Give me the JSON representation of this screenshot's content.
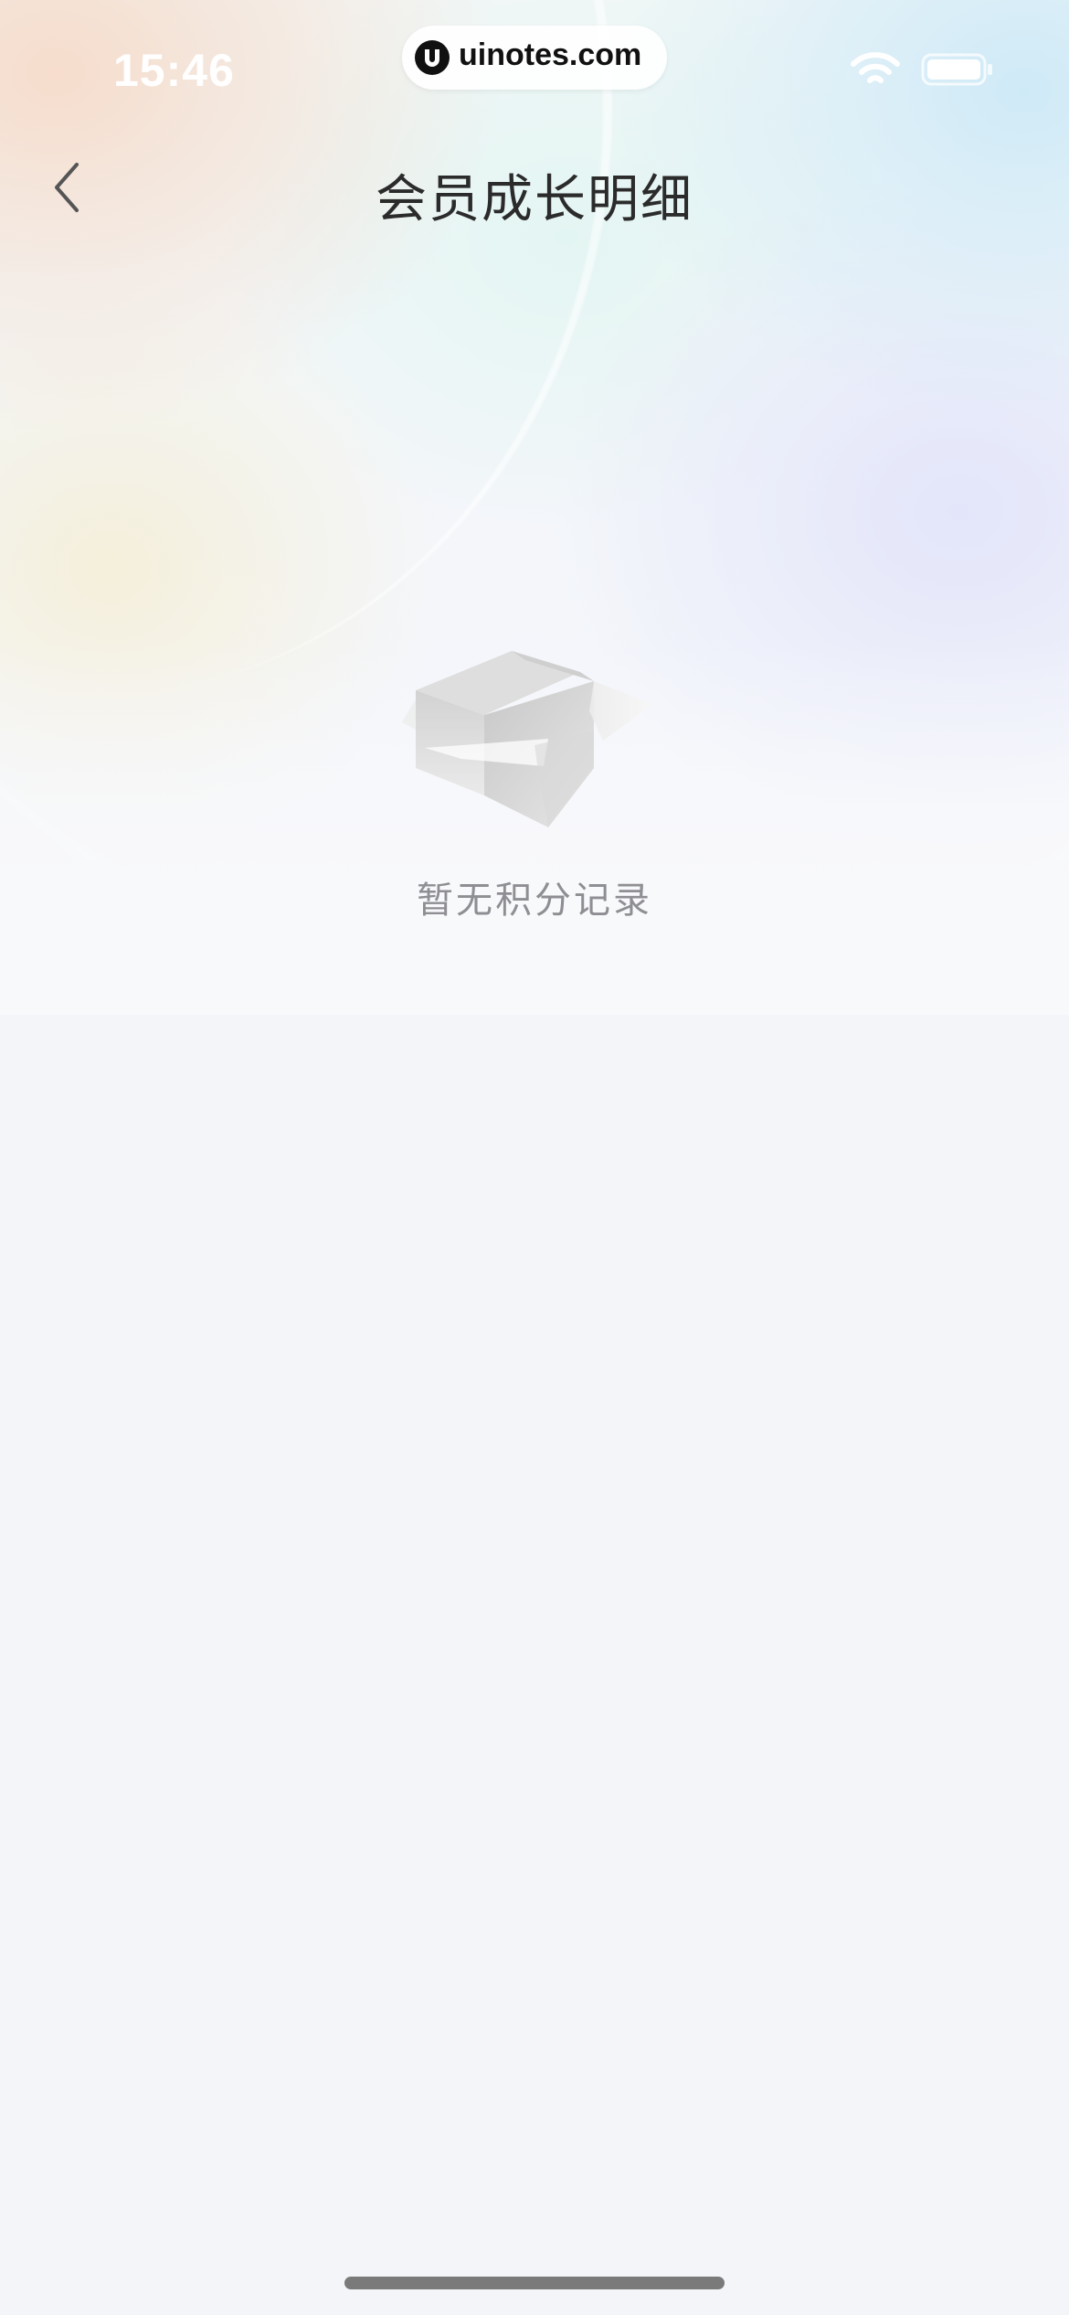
{
  "status_bar": {
    "time": "15:46",
    "url": "uinotes.com",
    "url_logo_icon": "uinotes-logo-icon",
    "wifi_icon": "wifi-icon",
    "battery_icon": "battery-icon"
  },
  "nav_bar": {
    "title": "会员成长明细",
    "back_icon": "chevron-left-icon"
  },
  "empty_state": {
    "icon": "empty-box-icon",
    "message": "暂无积分记录"
  },
  "colors": {
    "page_background": "#f4f5f8",
    "title_text": "#2b2b2b",
    "empty_text": "#8e8e93",
    "home_indicator": "#7a7a7a"
  }
}
